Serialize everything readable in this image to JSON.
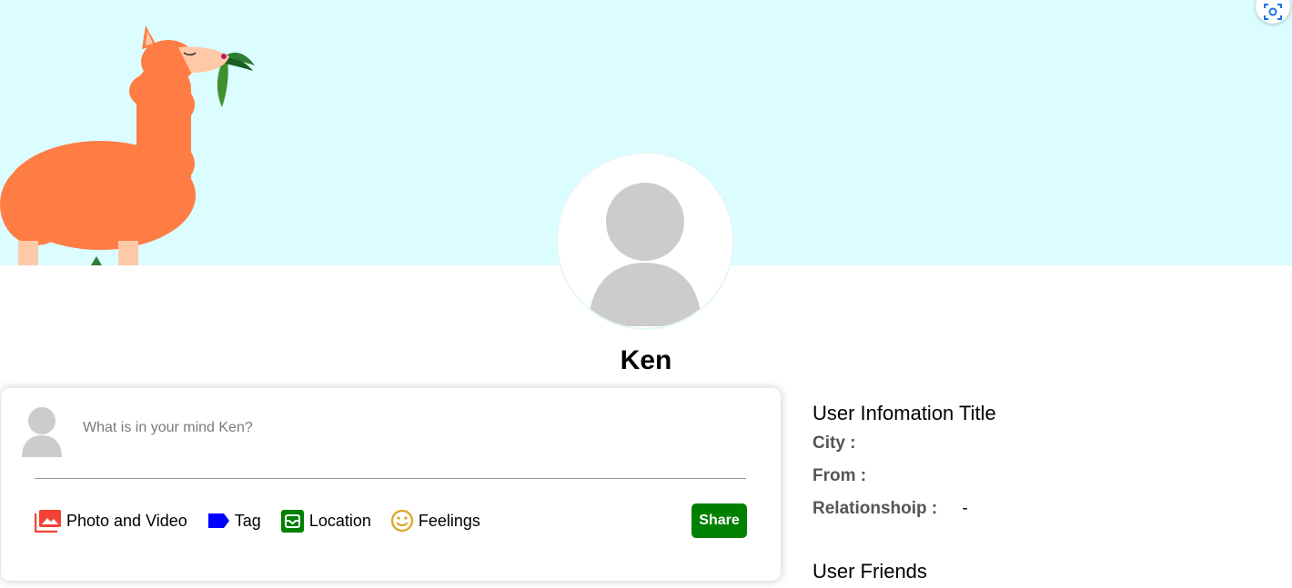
{
  "profile": {
    "name": "Ken",
    "cover_color": "#dbfdff"
  },
  "share": {
    "placeholder": "What is in your mind Ken?",
    "options": [
      {
        "label": "Photo and Video",
        "icon": "photo-library-icon",
        "color": "#f44336"
      },
      {
        "label": "Tag",
        "icon": "label-icon",
        "color": "#0000ff"
      },
      {
        "label": "Location",
        "icon": "location-pin-icon",
        "color": "#008000"
      },
      {
        "label": "Feelings",
        "icon": "emoji-icon",
        "color": "#daa520"
      }
    ],
    "button_label": "Share",
    "button_color": "#008000"
  },
  "user_info": {
    "title": "User Infomation Title",
    "city_label": "City :",
    "from_label": "From :",
    "relationship_label": "Relationshoip :",
    "relationship_value": "-"
  },
  "friends": {
    "title": "User Friends"
  }
}
